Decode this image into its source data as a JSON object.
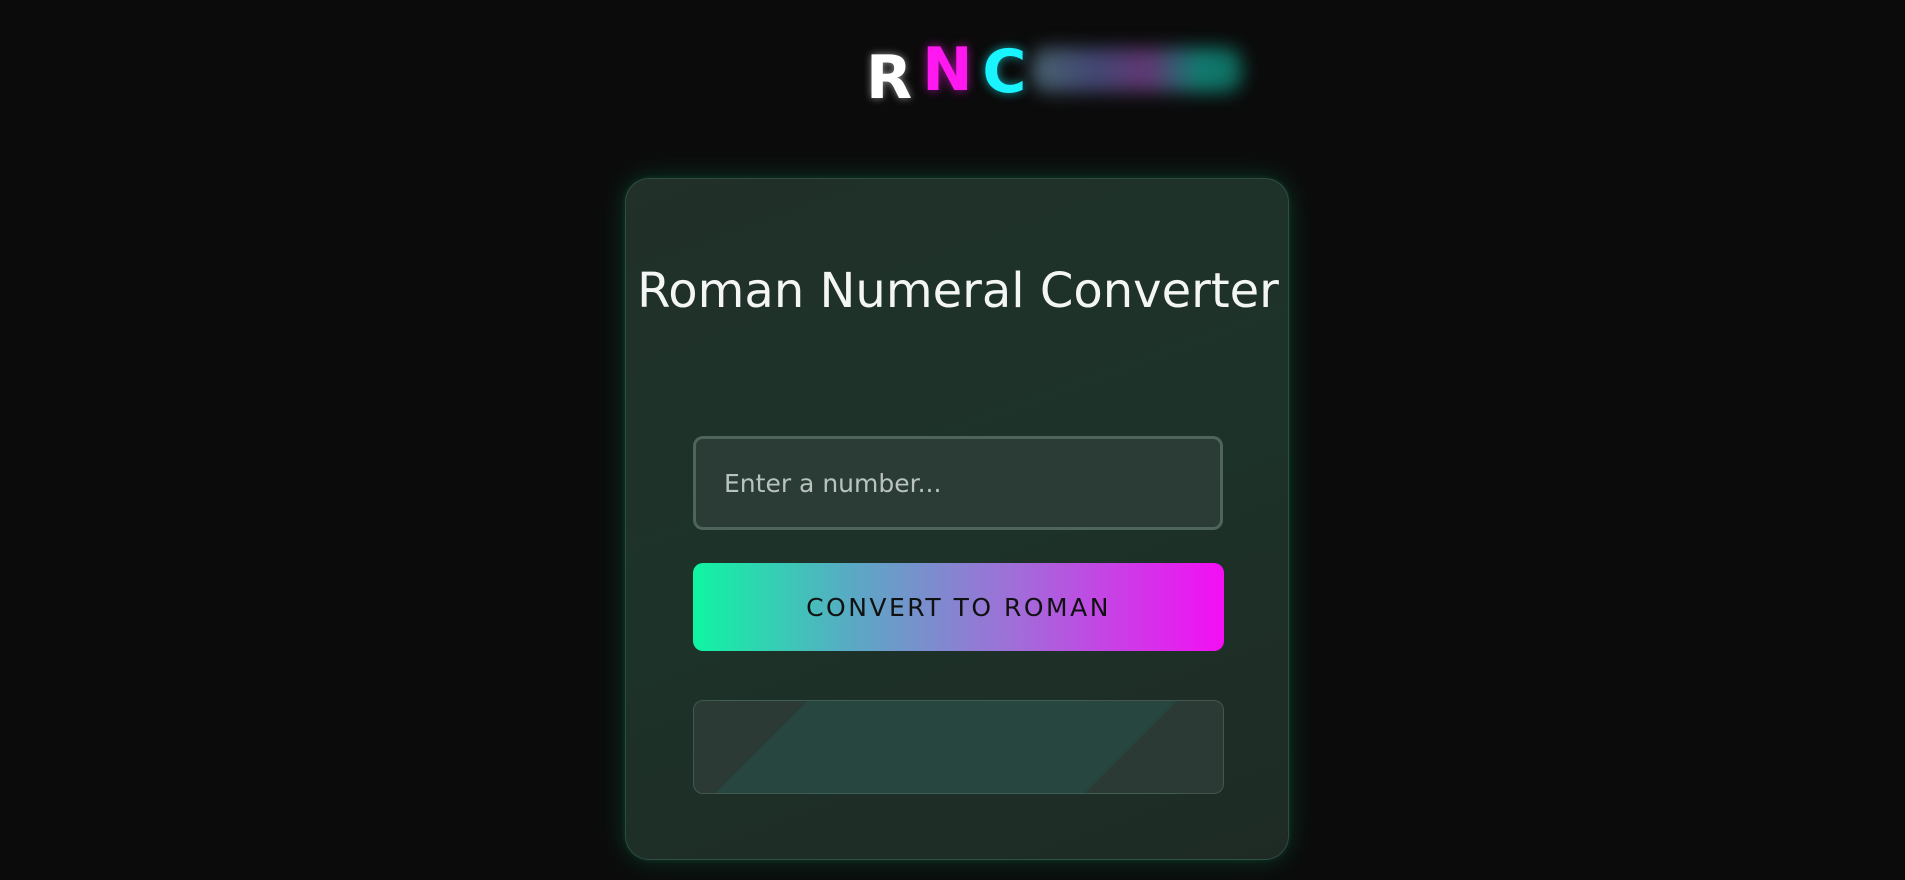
{
  "logo": {
    "letters": [
      "R",
      "N",
      "C"
    ]
  },
  "converter": {
    "title": "Roman Numeral Converter",
    "input_placeholder": "Enter a number...",
    "input_value": "",
    "convert_label": "CONVERT TO ROMAN",
    "result": ""
  },
  "colors": {
    "background": "#0b0b0b",
    "accent_green": "#0ff5a2",
    "accent_magenta": "#f40ef4",
    "accent_cyan": "#19f4ff"
  }
}
